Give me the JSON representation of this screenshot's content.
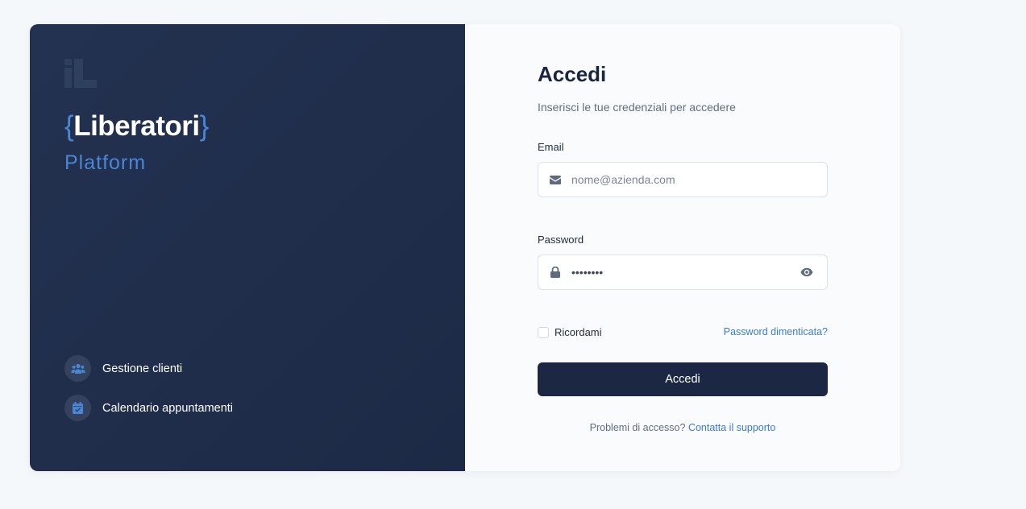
{
  "brand": {
    "brace_open": "{",
    "name": "Liberatori",
    "brace_close": "}",
    "tagline": "Platform"
  },
  "features": [
    {
      "label": "Gestione clienti",
      "icon": "users-icon"
    },
    {
      "label": "Calendario appuntamenti",
      "icon": "calendar-check-icon"
    }
  ],
  "login": {
    "title": "Accedi",
    "subtitle": "Inserisci le tue credenziali per accedere",
    "email_label": "Email",
    "email_placeholder": "nome@azienda.com",
    "password_label": "Password",
    "password_value": "••••••••",
    "remember_label": "Ricordami",
    "forgot_link": "Password dimenticata?",
    "submit_label": "Accedi",
    "help_text": "Problemi di accesso?",
    "help_link": "Contatta il supporto"
  },
  "colors": {
    "accent": "#4a86d6",
    "sidebar": "#1f2d4b",
    "button": "#1b2743",
    "link": "#3a7bd5"
  }
}
